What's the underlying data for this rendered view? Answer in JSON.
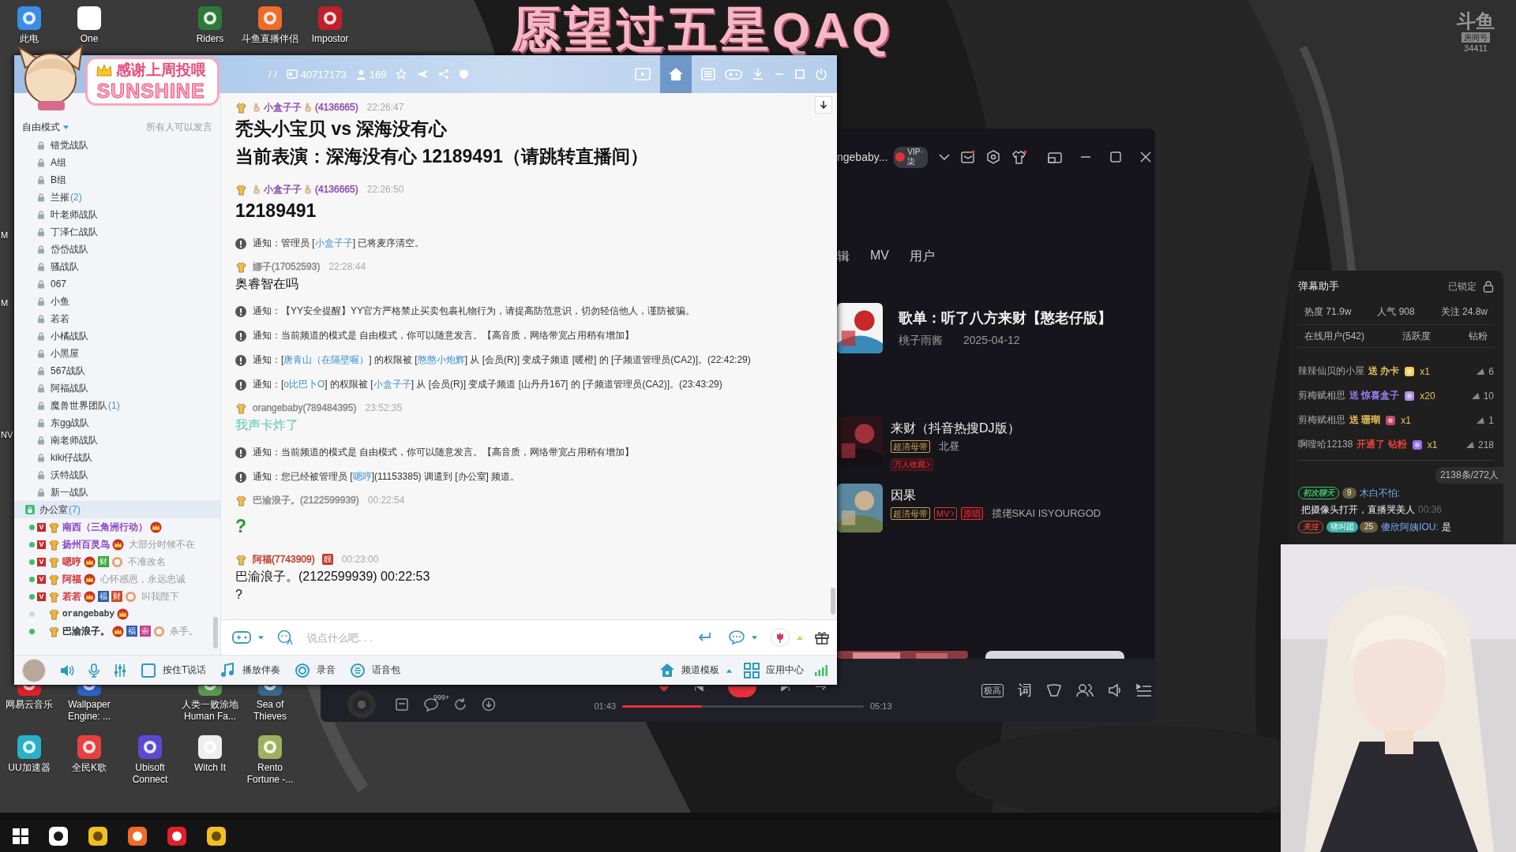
{
  "stream_title": "愿望过五星QAQ",
  "room_badge": {
    "logo": "斗鱼",
    "label": "房间号",
    "number": "34411"
  },
  "desktop_icons": [
    {
      "label": "此电"
    },
    {
      "label": "One"
    },
    {
      "label": "Riders"
    },
    {
      "label": "斗鱼直播伴侣"
    },
    {
      "label": "Impostor"
    },
    {
      "label": "网易云音乐"
    },
    {
      "label": "Wallpaper Engine: ..."
    },
    {
      "label": "人类一败涂地 Human Fa..."
    },
    {
      "label": "Sea of Thieves"
    },
    {
      "label": "UU加速器"
    },
    {
      "label": "全民K歌"
    },
    {
      "label": "Ubisoft Connect"
    },
    {
      "label": "Witch It"
    },
    {
      "label": "Rento Fortune -..."
    }
  ],
  "edge_labels": [
    "M",
    "M",
    "NV"
  ],
  "sticker": {
    "caption": "感谢上周投喂",
    "name": "SUNSHINE"
  },
  "yy": {
    "title_bar": {
      "breadcrumb": "/ /",
      "channel_id": "40717173",
      "users": "169"
    },
    "mode": "自由模式",
    "speak_rule": "所有人可以发言",
    "channels": [
      {
        "name": "错觉战队",
        "selected": false
      },
      {
        "name": "A组",
        "selected": false
      },
      {
        "name": "B组",
        "selected": false
      },
      {
        "name": "兰摧",
        "count": "(2)",
        "selected": false
      },
      {
        "name": "叶老师战队",
        "selected": false
      },
      {
        "name": "丁泽仁战队",
        "selected": false
      },
      {
        "name": "岱岱战队",
        "selected": false
      },
      {
        "name": "骚战队",
        "selected": false
      },
      {
        "name": "067",
        "selected": false
      },
      {
        "name": "小鱼",
        "selected": false
      },
      {
        "name": "若若",
        "selected": false
      },
      {
        "name": "小橘战队",
        "selected": false
      },
      {
        "name": "小黑屋",
        "selected": false
      },
      {
        "name": "567战队",
        "selected": false
      },
      {
        "name": "阿福战队",
        "selected": false
      },
      {
        "name": "魔兽世界团队",
        "count": "(1)",
        "selected": false
      },
      {
        "name": "东gg战队",
        "selected": false
      },
      {
        "name": "南老师战队",
        "selected": false
      },
      {
        "name": "kiki仔战队",
        "selected": false
      },
      {
        "name": "沃特战队",
        "selected": false
      },
      {
        "name": "新一战队",
        "selected": false
      },
      {
        "name": "办公室",
        "count": "(7)",
        "selected": true,
        "children": [
          {
            "name": "南西（三角洲行动）",
            "color": "#8b3fc4",
            "online": true,
            "badge": "V"
          },
          {
            "name": "扬州百灵鸟",
            "color": "#8b3fc4",
            "online": true,
            "badge": "V",
            "note": "大部分时候不在"
          },
          {
            "name": "嗯哼",
            "color": "#d0303a",
            "online": true,
            "badge": "V",
            "tiles": [
              {
                "text": "财",
                "color": "#3aa83a"
              }
            ],
            "note": "不准改名"
          },
          {
            "name": "阿福",
            "color": "#d0303a",
            "online": true,
            "badge": "V",
            "note": "心怀感恩，永远忠诚"
          },
          {
            "name": "若若",
            "color": "#d0303a",
            "online": true,
            "badge": "V",
            "tiles": [
              {
                "text": "福",
                "color": "#2e5fb0"
              },
              {
                "text": "财",
                "color": "#d04a2a"
              }
            ],
            "note": "叫我陛下"
          },
          {
            "name": "orangebaby",
            "color": "#333333",
            "online": false
          },
          {
            "name": "巴渝浪子。",
            "color": "#222222",
            "online": true,
            "tiles": [
              {
                "text": "福",
                "color": "#2e5fb0"
              },
              {
                "text": "崇",
                "color": "#c0408a"
              }
            ],
            "note": "杀手。"
          }
        ]
      }
    ],
    "messages": [
      {
        "kind": "post",
        "user": "小盒子子",
        "uid": "(4136665)",
        "flair": true,
        "color": "#8b4fb0",
        "time": "22:26:47",
        "large": true,
        "lines": [
          "秃头小宝贝 vs 深海没有心",
          "当前表演：深海没有心  12189491（请跳转直播间）"
        ]
      },
      {
        "kind": "post",
        "user": "小盒子子",
        "uid": "(4136665)",
        "flair": true,
        "color": "#8b4fb0",
        "time": "22:26:50",
        "large": true,
        "lines": [
          "12189491"
        ]
      },
      {
        "kind": "notice",
        "parts": [
          {
            "text": "通知：管理员 ["
          },
          {
            "text": "小盒子子",
            "kind": "link"
          },
          {
            "text": "] 已将麦序清空。"
          }
        ]
      },
      {
        "kind": "post",
        "user": "娜子",
        "uid": "(17052593)",
        "flair": false,
        "color": "#888888",
        "time": "22:28:44",
        "large": false,
        "lines": [
          "奥睿智在吗"
        ]
      },
      {
        "kind": "notice",
        "parts": [
          {
            "text": "通知：【YY安全提醒】YY官方严格禁止买卖包裹礼物行为，请提高防范意识，切勿轻信他人，谨防被骗。"
          }
        ]
      },
      {
        "kind": "notice",
        "parts": [
          {
            "text": "通知：当前频道的模式是 自由模式，你可以随意发言。【高音质，网络带宽占用稍有增加】"
          }
        ]
      },
      {
        "kind": "notice",
        "parts": [
          {
            "text": "通知：["
          },
          {
            "text": "唐青山（在隔壁喔）",
            "kind": "link"
          },
          {
            "text": "] 的权限被 ["
          },
          {
            "text": "憨憨小炮辉",
            "kind": "link"
          },
          {
            "text": "] 从 [会员(R)] 变成子频道 [暖橙] 的 [子频道管理员(CA2)]。(22:42:29)"
          }
        ]
      },
      {
        "kind": "notice",
        "parts": [
          {
            "text": "通知：["
          },
          {
            "text": "o比巴卜O",
            "kind": "link"
          },
          {
            "text": "] 的权限被 ["
          },
          {
            "text": "小盒子子",
            "kind": "link"
          },
          {
            "text": "] 从 [会员(R)] 变成子频道 [山丹丹167] 的 [子频道管理员(CA2)]。(23:43:29)"
          }
        ]
      },
      {
        "kind": "post",
        "user": "orangebaby",
        "uid": "(789484395)",
        "flair": false,
        "color": "#888888",
        "time": "23:52:35",
        "large": false,
        "body": {
          "color": "#5cc9b4"
        },
        "lines": [
          "我声卡炸了"
        ]
      },
      {
        "kind": "notice",
        "parts": [
          {
            "text": "通知：当前频道的模式是 自由模式，你可以随意发言。【高音质，网络带宽占用稍有增加】"
          }
        ]
      },
      {
        "kind": "notice",
        "parts": [
          {
            "text": "通知：您已经被管理员 ["
          },
          {
            "text": "嗯哼",
            "kind": "link"
          },
          {
            "text": "](11153385) 调遣到 [办公室] 频道。"
          }
        ]
      },
      {
        "kind": "post",
        "user": "巴渝浪子。",
        "uid": "(2122599939)",
        "flair": false,
        "color": "#888888",
        "time": "00:22:54",
        "large": true,
        "body": {
          "color": "#2a9a2a"
        },
        "lines": [
          "?"
        ]
      },
      {
        "kind": "post",
        "user": "阿福",
        "uid": "(7743909)",
        "flair": false,
        "color": "#c0392b",
        "badge": "靓",
        "time": "00:23:00",
        "large": false,
        "lines": [
          "巴渝浪子。(2122599939) 00:22:53",
          "?"
        ]
      }
    ],
    "input": {
      "placeholder": "说点什么吧. . ."
    },
    "toolbar": [
      {
        "label": "按住T说话"
      },
      {
        "label": "播放伴奏"
      },
      {
        "label": "录音"
      },
      {
        "label": "语音包"
      },
      {
        "label": "频道模板"
      },
      {
        "label": "应用中心"
      }
    ]
  },
  "music": {
    "account": "ngebaby...",
    "vip": "VIP·柒",
    "tabs": [
      {
        "label": "辑"
      },
      {
        "label": "MV"
      },
      {
        "label": "用户"
      }
    ],
    "playlist": {
      "title": "歌单：听了八方来财【憨老仔版】",
      "creator": "桃子雨酱",
      "date": "2025-04-12"
    },
    "songs": [
      {
        "title": "来财（抖音热搜DJ版）",
        "tags": [
          {
            "label": "超清母带",
            "kind": "quality"
          }
        ],
        "artist": "北昼",
        "extra": "万人收藏"
      },
      {
        "title": "因果",
        "tags": [
          {
            "label": "超清母带",
            "kind": "quality"
          },
          {
            "label": "MV",
            "kind": "mv"
          },
          {
            "label": "原唱",
            "kind": "original"
          }
        ],
        "artist": "揽佬SKAI ISYOURGOD"
      }
    ],
    "player": {
      "elapsed": "01:43",
      "duration": "05:13",
      "level": 0.33,
      "comments": "999+",
      "quality": "极高",
      "lyrics": "词"
    }
  },
  "danmaku": {
    "title": "弹幕助手",
    "lock": "已锁定",
    "stats": [
      "热度 71.9w",
      "人气 908",
      "关注 24.8w"
    ],
    "tabs": [
      {
        "label": "在线用户(542)"
      },
      {
        "label": "活跃度"
      },
      {
        "label": "钻粉"
      }
    ],
    "gifts": [
      {
        "user": "辣辣仙贝的小屋",
        "action": "送 办卡",
        "color": "#e8c25a",
        "count": "x1",
        "rank": "6"
      },
      {
        "user": "剪梅赋相思",
        "action": "送 惊喜盒子",
        "color": "#9b7cf0",
        "count": "x20",
        "rank": "10"
      },
      {
        "user": "剪梅赋相思",
        "action": "送 珊瑚",
        "color": "#e8c25a",
        "count": "x1",
        "rank": "1"
      },
      {
        "user": "啊嗖哈12138",
        "action": "开通了 钻粉",
        "color": "#e8453c",
        "count": "x1",
        "rank": "218"
      }
    ],
    "summary": "2138条/272人",
    "chat": [
      {
        "kind": "first_chat",
        "badge": "初次聊天",
        "fans_level": "9",
        "user": "木白不怕:",
        "text": "把摄像头打开，直播哭美人",
        "time": "00:36"
      },
      {
        "kind": "follow",
        "badge": "关注",
        "club": "猪叫团",
        "fans_level": "25",
        "user": "傻欣阿姨IOU:",
        "text": "是"
      }
    ]
  }
}
